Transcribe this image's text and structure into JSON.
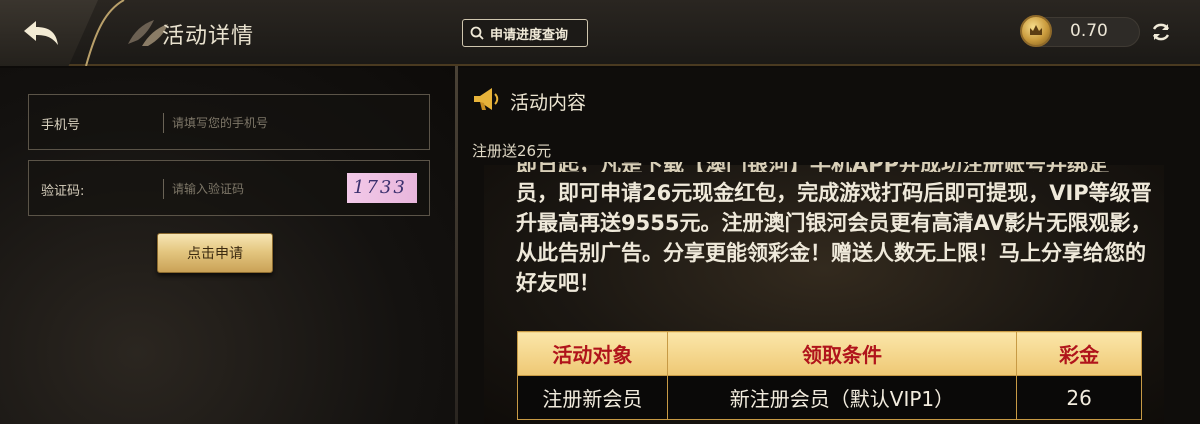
{
  "header": {
    "back_icon": "back-arrow-icon",
    "title": "活动详情",
    "query_button": "申请进度查询",
    "balance": "0.70",
    "coin_icon": "crown-coin-icon",
    "refresh_icon": "refresh-icon"
  },
  "form": {
    "phone_label": "手机号",
    "phone_placeholder": "请填写您的手机号",
    "code_label": "验证码:",
    "code_placeholder": "请输入验证码",
    "captcha_text": "1733",
    "apply_button": "点击申请"
  },
  "content": {
    "heading_icon": "megaphone-icon",
    "heading": "活动内容",
    "subtitle": "注册送26元",
    "cut_line": "即日起，凡是下载【澳门银河】手机APP并成功注册账号并绑定",
    "description": "员，即可申请26元现金红包，完成游戏打码后即可提现，VIP等级晋升最高再送9555元。注册澳门银河会员更有高清AV影片无限观影，从此告别广告。分享更能领彩金！赠送人数无上限！马上分享给您的好友吧！",
    "table": {
      "headers": [
        "活动对象",
        "领取条件",
        "彩金"
      ],
      "rows": [
        [
          "注册新会员",
          "新注册会员（默认VIP1）",
          "26"
        ]
      ]
    }
  }
}
